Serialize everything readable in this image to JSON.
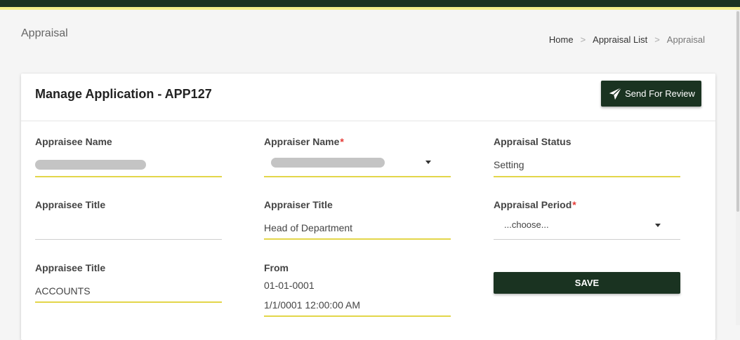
{
  "page": {
    "title": "Appraisal"
  },
  "breadcrumb": {
    "items": [
      "Home",
      "Appraisal List",
      "Appraisal"
    ],
    "separator": ">"
  },
  "card": {
    "title": "Manage Application - APP127",
    "send_button": {
      "label": "Send For Review",
      "icon": "paper-plane-icon"
    }
  },
  "form": {
    "appraisee_name": {
      "label": "Appraisee Name",
      "value_redacted": true
    },
    "appraiser_name": {
      "label": "Appraiser Name",
      "required_mark": "*",
      "value_redacted": true
    },
    "appraisal_status": {
      "label": "Appraisal Status",
      "value": "Setting"
    },
    "appraisee_title_1": {
      "label": "Appraisee Title",
      "value": ""
    },
    "appraiser_title": {
      "label": "Appraiser Title",
      "value": "Head of Department"
    },
    "appraisal_period": {
      "label": "Appraisal Period",
      "required_mark": "*",
      "selected": "...choose..."
    },
    "appraisee_title_2": {
      "label": "Appraisee Title",
      "value": "ACCOUNTS"
    },
    "from": {
      "label": "From",
      "value": "01-01-0001",
      "value_datetime": "1/1/0001 12:00:00 AM"
    },
    "save_button": {
      "label": "SAVE"
    }
  },
  "colors": {
    "brand_dark": "#1a3321",
    "accent_yellow": "#e3d64a",
    "top_accent": "#f2ef8a",
    "required": "#e53935"
  }
}
